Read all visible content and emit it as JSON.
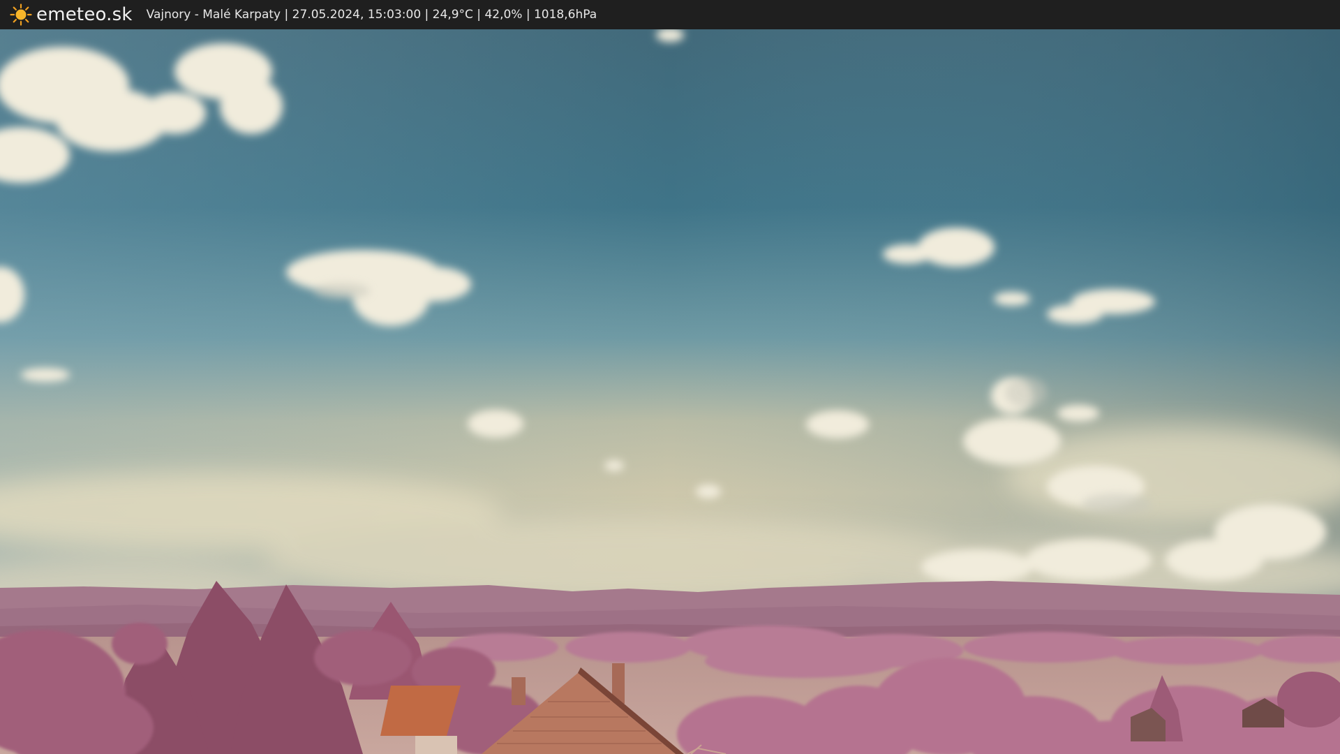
{
  "header": {
    "logo_icon": "sun-icon",
    "brand": "emeteo.sk",
    "caption": "Vajnory - Malé Karpaty | 27.05.2024, 15:03:00 | 24,9°C | 42,0% | 1018,6hPa"
  },
  "colors": {
    "topbar": "#1f1f1f",
    "sun": "#f0a020",
    "sky_top": "#3f6f83",
    "sky_horizon": "#cfc9ad",
    "hills": "#a77d90",
    "foliage": "#a96b84"
  }
}
